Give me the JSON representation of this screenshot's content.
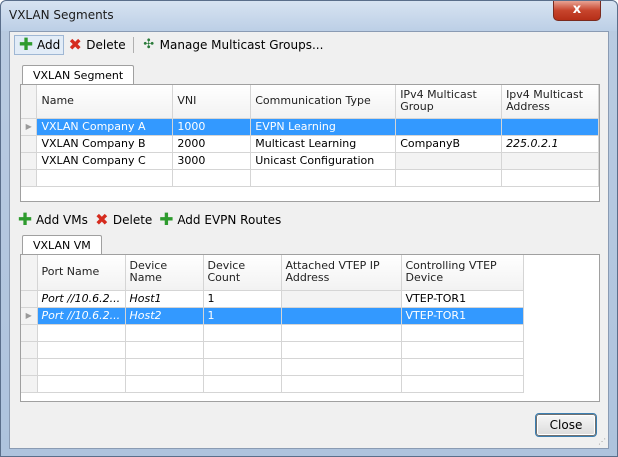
{
  "window": {
    "title": "VXLAN Segments",
    "close_glyph": "x"
  },
  "top_toolbar": {
    "add_label": "Add",
    "delete_label": "Delete",
    "manage_label": "Manage Multicast Groups..."
  },
  "segment_tab": {
    "label": "VXLAN Segment"
  },
  "segment_grid": {
    "headers": [
      "Name",
      "VNI",
      "Communication Type",
      "IPv4 Multicast Group",
      "Ipv4 Multicast Address"
    ],
    "rows": [
      {
        "name": "VXLAN Company A",
        "vni": "1000",
        "comm": "EVPN Learning",
        "group": "",
        "address": "",
        "selected": true
      },
      {
        "name": "VXLAN Company B",
        "vni": "2000",
        "comm": "Multicast Learning",
        "group": "CompanyB",
        "address": "225.0.2.1",
        "selected": false
      },
      {
        "name": "VXLAN Company C",
        "vni": "3000",
        "comm": "Unicast Configuration",
        "group": "",
        "address": "",
        "selected": false
      }
    ]
  },
  "vm_toolbar": {
    "add_vms_label": "Add VMs",
    "delete_label": "Delete",
    "add_evpn_label": "Add EVPN Routes"
  },
  "vm_tab": {
    "label": "VXLAN VM"
  },
  "vm_grid": {
    "headers": [
      "Port Name",
      "Device Name",
      "Device Count",
      "Attached VTEP IP Address",
      "Controlling VTEP Device"
    ],
    "rows": [
      {
        "port": "Port //10.6.2...",
        "device": "Host1",
        "count": "1",
        "vtep_ip": "",
        "controlling": "VTEP-TOR1",
        "selected": false
      },
      {
        "port": "Port //10.6.2...",
        "device": "Host2",
        "count": "1",
        "vtep_ip": "",
        "controlling": "VTEP-TOR1",
        "selected": true
      }
    ]
  },
  "footer": {
    "close_label": "Close"
  },
  "colors": {
    "selection": "#3399ff",
    "add_green": "#2e9b2e",
    "delete_red": "#d52b1e"
  }
}
